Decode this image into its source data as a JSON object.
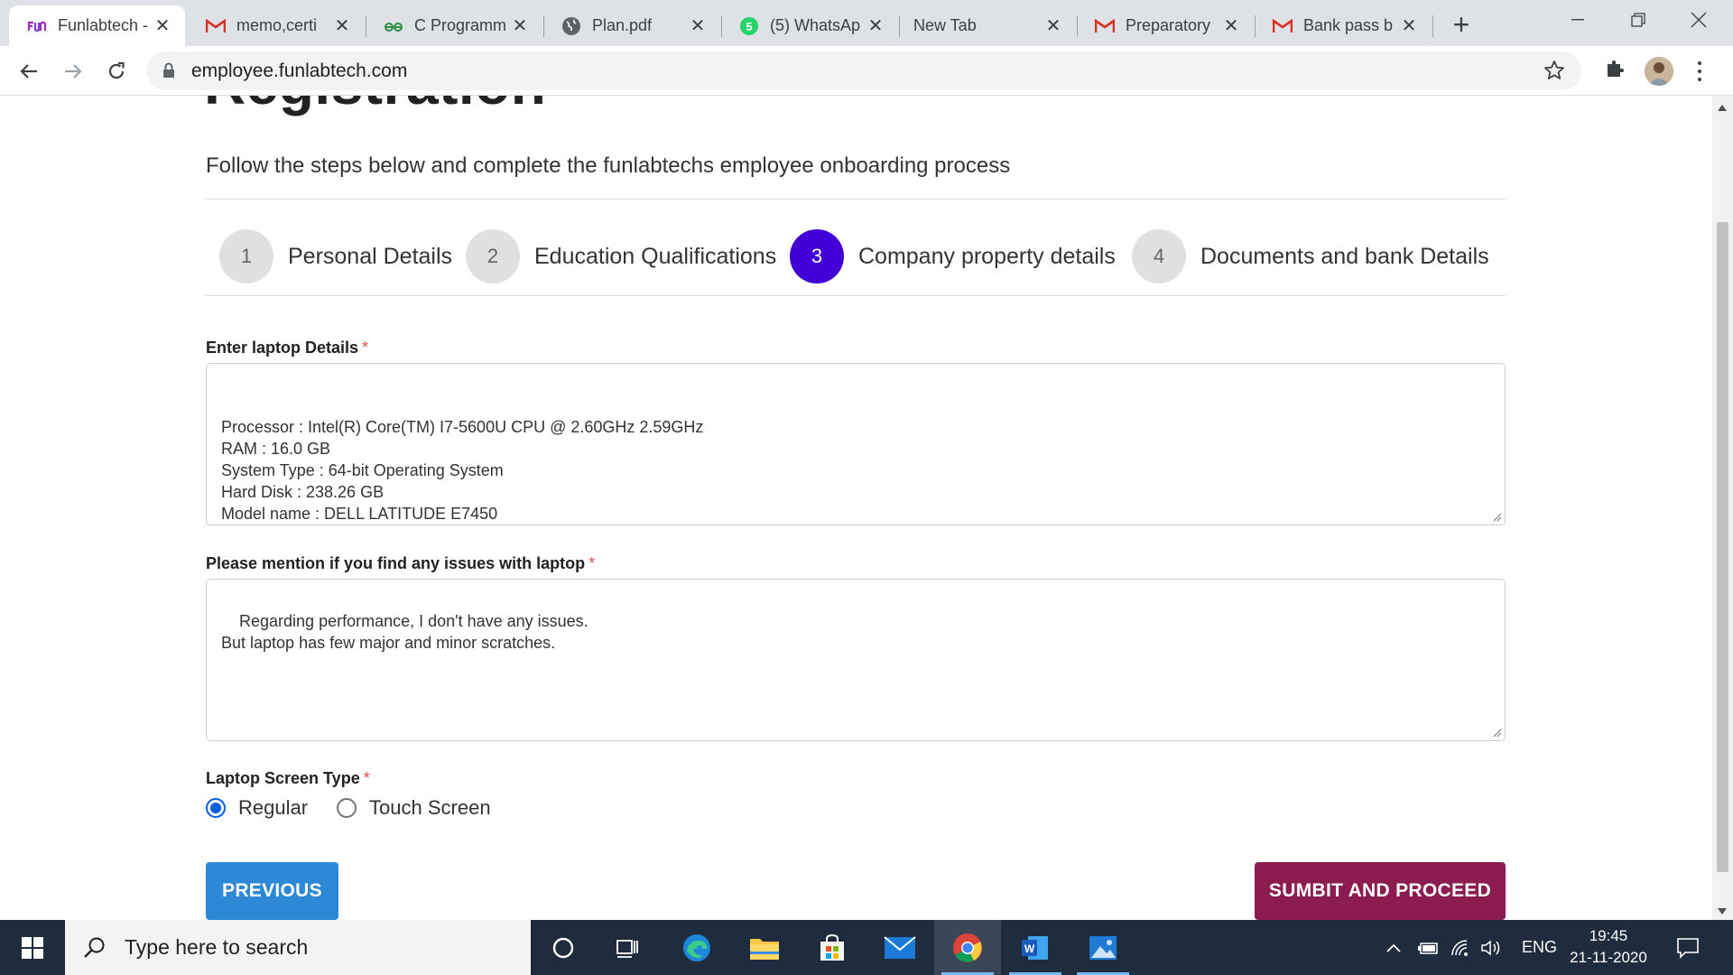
{
  "browser": {
    "tabs": [
      {
        "title": "Funlabtech -",
        "icon": "funlabtech-logo",
        "active": true
      },
      {
        "title": "memo,certi",
        "icon": "gmail-icon"
      },
      {
        "title": "C Programm",
        "icon": "geeksforgeeks-icon"
      },
      {
        "title": "Plan.pdf",
        "icon": "globe-icon"
      },
      {
        "title": "(5) WhatsAp",
        "icon": "whatsapp-icon"
      },
      {
        "title": "New Tab",
        "icon": ""
      },
      {
        "title": "Preparatory",
        "icon": "gmail-icon"
      },
      {
        "title": "Bank pass b",
        "icon": "gmail-icon"
      }
    ],
    "url": "employee.funlabtech.com"
  },
  "page": {
    "title": "Registration",
    "subtitle": "Follow the steps below and complete the funlabtechs employee onboarding process",
    "steps": [
      {
        "num": "1",
        "label": "Personal Details"
      },
      {
        "num": "2",
        "label": "Education Qualifications"
      },
      {
        "num": "3",
        "label": "Company property details",
        "active": true
      },
      {
        "num": "4",
        "label": "Documents and bank Details"
      }
    ],
    "laptop_details": {
      "label": "Enter laptop Details",
      "required": "*",
      "value": "\nProcessor : Intel(R) Core(TM) I7-5600U CPU @ 2.60GHz 2.59GHz\nRAM : 16.0 GB\nSystem Type : 64-bit Operating System\nHard Disk : 238.26 GB\nModel name : DELL LATITUDE E7450"
    },
    "laptop_issues": {
      "label": "Please mention if you find any issues with laptop",
      "required": "*",
      "value": "Regarding performance, I don't have any issues.\nBut laptop has few major and minor scratches."
    },
    "screen_type": {
      "label": "Laptop Screen Type",
      "required": "*",
      "options": [
        "Regular",
        "Touch Screen"
      ],
      "selected": "Regular"
    },
    "buttons": {
      "previous": "PREVIOUS",
      "submit": "SUMBIT AND PROCEED"
    }
  },
  "taskbar": {
    "search_placeholder": "Type here to search",
    "language": "ENG",
    "time": "19:45",
    "date": "21-11-2020"
  },
  "colors": {
    "active_step": "#4200d6",
    "previous_button": "#2d89d6",
    "submit_button": "#8c1c4f",
    "required": "#d9534f"
  }
}
